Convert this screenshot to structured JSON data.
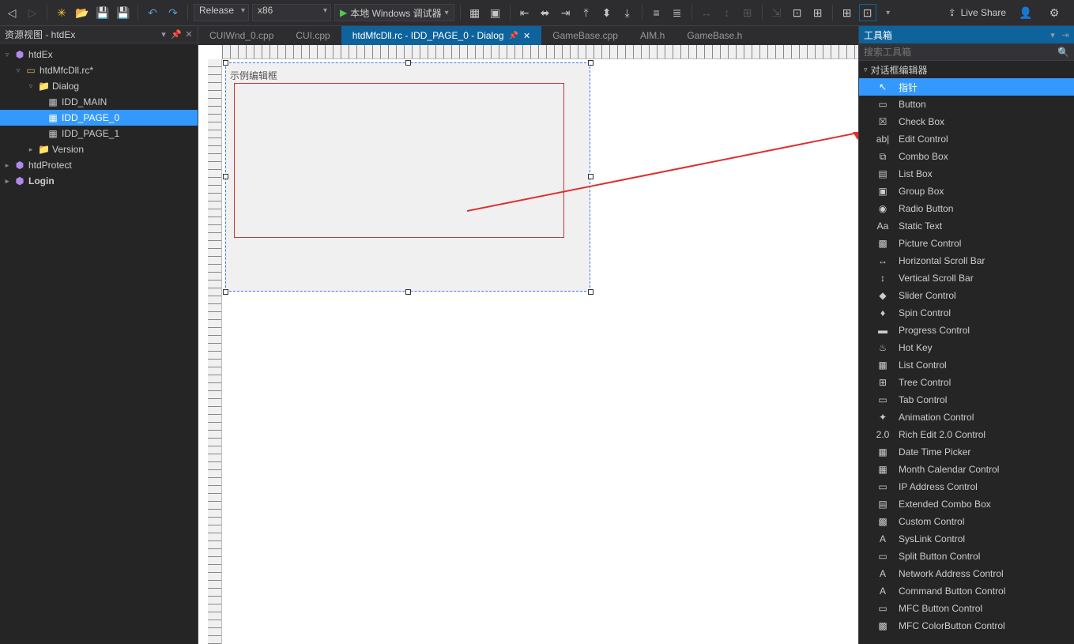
{
  "toolbar": {
    "config": "Release",
    "platform": "x86",
    "run_label": "本地 Windows 调试器",
    "live_share": "Live Share"
  },
  "left_pane": {
    "title": "资源视图 - htdEx",
    "tree": {
      "root": "htdEx",
      "rc": "htdMfcDll.rc*",
      "dialog_folder": "Dialog",
      "dlg_main": "IDD_MAIN",
      "dlg_page0": "IDD_PAGE_0",
      "dlg_page1": "IDD_PAGE_1",
      "version": "Version",
      "htdprotect": "htdProtect",
      "login": "Login"
    }
  },
  "tabs": {
    "t0": "CUIWnd_0.cpp",
    "t1": "CUI.cpp",
    "t2": "htdMfcDll.rc - IDD_PAGE_0 - Dialog",
    "t3": "GameBase.cpp",
    "t4": "AIM.h",
    "t5": "GameBase.h"
  },
  "designer": {
    "edit_label": "示例编辑框"
  },
  "toolbox": {
    "title": "工具箱",
    "search_placeholder": "搜索工具箱",
    "group": "对话框编辑器",
    "items": [
      {
        "icon": "↖",
        "label": "指针"
      },
      {
        "icon": "▭",
        "label": "Button"
      },
      {
        "icon": "☒",
        "label": "Check Box"
      },
      {
        "icon": "ab|",
        "label": "Edit Control"
      },
      {
        "icon": "⧉",
        "label": "Combo Box"
      },
      {
        "icon": "▤",
        "label": "List Box"
      },
      {
        "icon": "▣",
        "label": "Group Box"
      },
      {
        "icon": "◉",
        "label": "Radio Button"
      },
      {
        "icon": "Aa",
        "label": "Static Text"
      },
      {
        "icon": "▩",
        "label": "Picture Control"
      },
      {
        "icon": "↔",
        "label": "Horizontal Scroll Bar"
      },
      {
        "icon": "↕",
        "label": "Vertical Scroll Bar"
      },
      {
        "icon": "◆",
        "label": "Slider Control"
      },
      {
        "icon": "♦",
        "label": "Spin Control"
      },
      {
        "icon": "▬",
        "label": "Progress Control"
      },
      {
        "icon": "♨",
        "label": "Hot Key"
      },
      {
        "icon": "▦",
        "label": "List Control"
      },
      {
        "icon": "⊞",
        "label": "Tree Control"
      },
      {
        "icon": "▭",
        "label": "Tab Control"
      },
      {
        "icon": "✦",
        "label": "Animation Control"
      },
      {
        "icon": "2.0",
        "label": "Rich Edit 2.0 Control"
      },
      {
        "icon": "▦",
        "label": "Date Time Picker"
      },
      {
        "icon": "▦",
        "label": "Month Calendar Control"
      },
      {
        "icon": "▭",
        "label": "IP Address Control"
      },
      {
        "icon": "▤",
        "label": "Extended Combo Box"
      },
      {
        "icon": "▩",
        "label": "Custom Control"
      },
      {
        "icon": "A",
        "label": "SysLink Control"
      },
      {
        "icon": "▭",
        "label": "Split Button Control"
      },
      {
        "icon": "A",
        "label": "Network Address Control"
      },
      {
        "icon": "A",
        "label": "Command Button Control"
      },
      {
        "icon": "▭",
        "label": "MFC Button Control"
      },
      {
        "icon": "▩",
        "label": "MFC ColorButton Control"
      }
    ]
  }
}
